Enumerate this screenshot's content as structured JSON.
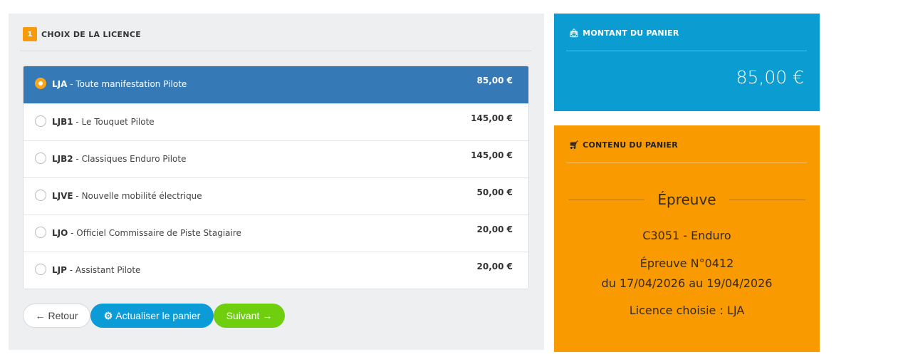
{
  "choice_section": {
    "step_number": "1",
    "title": "CHOIX DE LA LICENCE"
  },
  "licenses": [
    {
      "code": "LJA",
      "label": " - Toute manifestation Pilote",
      "price": "85,00 €",
      "selected": true
    },
    {
      "code": "LJB1",
      "label": " - Le Touquet Pilote",
      "price": "145,00 €",
      "selected": false
    },
    {
      "code": "LJB2",
      "label": " - Classiques Enduro Pilote",
      "price": "145,00 €",
      "selected": false
    },
    {
      "code": "LJVE",
      "label": " - Nouvelle mobilité électrique",
      "price": "50,00 €",
      "selected": false
    },
    {
      "code": "LJO",
      "label": " - Officiel Commissaire de Piste Stagiaire",
      "price": "20,00 €",
      "selected": false
    },
    {
      "code": "LJP",
      "label": " - Assistant Pilote",
      "price": "20,00 €",
      "selected": false
    }
  ],
  "buttons": {
    "back_label": "Retour",
    "update_label": "Actualiser le panier",
    "next_label": "Suivant"
  },
  "amount_panel": {
    "title": "MONTANT DU PANIER",
    "icon": "shopping-bag-icon",
    "value": "85,00 €"
  },
  "cart_panel": {
    "title": "CONTENU DU PANIER",
    "icon": "cart-icon",
    "event_heading": "Épreuve",
    "event_name": "C3051 - Enduro",
    "event_number": "Épreuve N°0412",
    "event_dates": "du 17/04/2026 au 19/04/2026",
    "chosen_license": "Licence choisie : LJA"
  },
  "colors": {
    "selected_row": "#3579b6",
    "step_badge": "#f79a0c",
    "amount_panel": "#0b9cd2",
    "cart_panel": "#f89a00",
    "update_button": "#0b9cd8",
    "next_button": "#6fcf0f"
  }
}
